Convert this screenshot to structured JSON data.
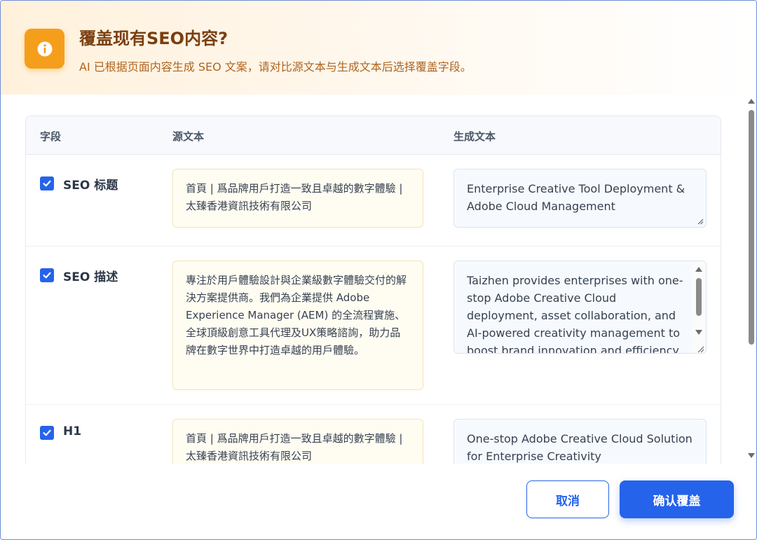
{
  "dialog": {
    "title": "覆盖现有SEO内容?",
    "subtitle": "AI 已根据页面内容生成 SEO 文案，请对比源文本与生成文本后选择覆盖字段。",
    "header_icon": "info-icon"
  },
  "table": {
    "headers": {
      "field": "字段",
      "source": "源文本",
      "generated": "生成文本"
    },
    "rows": [
      {
        "checked": true,
        "field": "SEO 标题",
        "source": "首頁 | 爲品牌用戶打造一致且卓越的數字體驗 | 太臻香港資訊技術有限公司",
        "generated": "Enterprise Creative Tool Deployment & Adobe Cloud Management"
      },
      {
        "checked": true,
        "field": "SEO 描述",
        "source": "專注於用戶體驗設計與企業級數字體驗交付的解決方案提供商。我們為企業提供 Adobe Experience Manager (AEM) 的全流程實施、全球頂級創意工具代理及UX策略諮詢，助力品牌在數字世界中打造卓越的用戶體驗。",
        "generated": "Taizhen provides enterprises with one-stop Adobe Creative Cloud deployment, asset collaboration, and AI-powered creativity management to boost brand innovation and efficiency."
      },
      {
        "checked": true,
        "field": "H1",
        "source": "首頁 | 爲品牌用戶打造一致且卓越的數字體驗 | 太臻香港資訊技術有限公司",
        "generated": "One-stop Adobe Creative Cloud Solution for Enterprise Creativity"
      }
    ]
  },
  "footer": {
    "cancel_label": "取消",
    "confirm_label": "确认覆盖"
  },
  "colors": {
    "accent": "#2563eb",
    "warning_icon_bg": "#f59e1b",
    "title_color": "#7a3f10",
    "subtitle_color": "#b0641d"
  }
}
